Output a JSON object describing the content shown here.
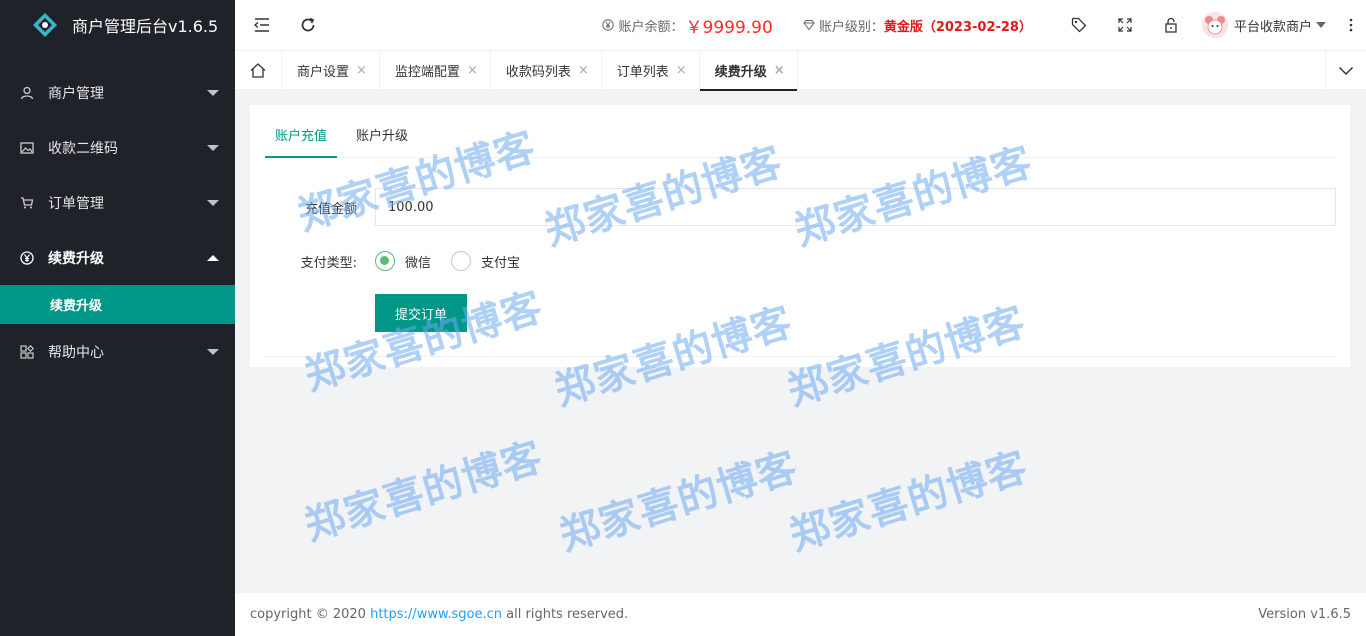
{
  "app": {
    "title": "商户管理后台v1.6.5"
  },
  "sidebar": {
    "items": [
      {
        "label": "商户管理",
        "icon": "user-icon"
      },
      {
        "label": "收款二维码",
        "icon": "image-icon"
      },
      {
        "label": "订单管理",
        "icon": "cart-icon"
      },
      {
        "label": "续费升级",
        "icon": "yen-icon",
        "sub": [
          {
            "label": "续费升级"
          }
        ]
      },
      {
        "label": "帮助中心",
        "icon": "apps-icon"
      }
    ]
  },
  "header": {
    "balance_label": "账户余额：",
    "balance_value": "￥9999.90",
    "level_label": "账户级别：",
    "level_value": "黄金版（2023-02-28）",
    "username": "平台收款商户"
  },
  "tabs": [
    {
      "label": "商户设置"
    },
    {
      "label": "监控端配置"
    },
    {
      "label": "收款码列表"
    },
    {
      "label": "订单列表"
    },
    {
      "label": "续费升级"
    }
  ],
  "tab_close_glyph": "×",
  "inner_tabs": [
    {
      "label": "账户充值"
    },
    {
      "label": "账户升级"
    }
  ],
  "form": {
    "amount_label": "充值金额",
    "amount_value": "100.00",
    "pay_type_label": "支付类型:",
    "options": [
      {
        "label": "微信"
      },
      {
        "label": "支付宝"
      }
    ],
    "submit_label": "提交订单"
  },
  "watermark": "郑家喜的博客",
  "footer": {
    "copyright_prefix": "copyright © 2020",
    "link_text": "https://www.sgoe.cn",
    "copyright_suffix": "all rights reserved.",
    "version": "Version v1.6.5"
  },
  "colors": {
    "accent": "#009688",
    "sidebar_bg": "#20222a",
    "balance": "#ff2a2a",
    "level": "#e0191a",
    "link": "#1e9fff"
  }
}
